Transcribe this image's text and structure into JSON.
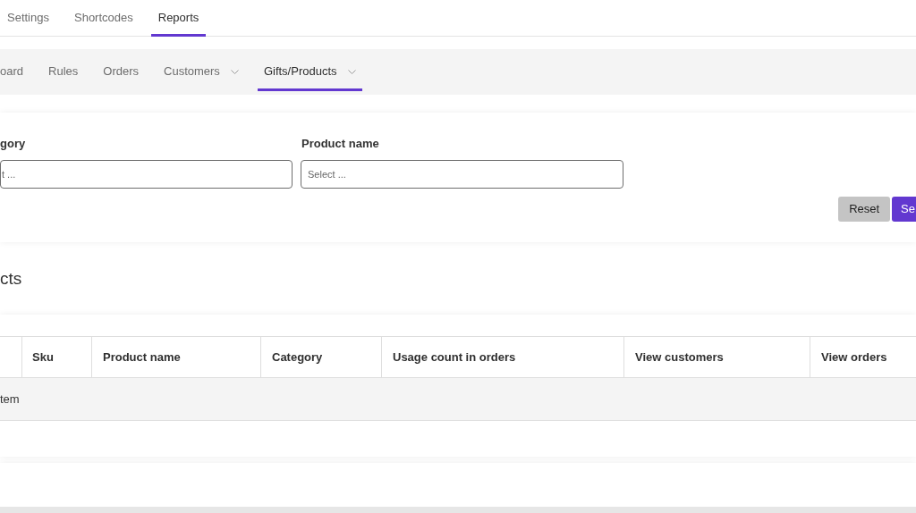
{
  "top_tabs": [
    {
      "label": "Settings",
      "selected": false
    },
    {
      "label": "Shortcodes",
      "selected": false
    },
    {
      "label": "Reports",
      "selected": true
    }
  ],
  "sub_tabs": [
    {
      "label": "oard",
      "selected": false,
      "dropdown": false
    },
    {
      "label": "Rules",
      "selected": false,
      "dropdown": false
    },
    {
      "label": "Orders",
      "selected": false,
      "dropdown": false
    },
    {
      "label": "Customers",
      "selected": false,
      "dropdown": true
    },
    {
      "label": "Gifts/Products",
      "selected": true,
      "dropdown": true
    }
  ],
  "filters": {
    "fields": [
      {
        "label": "gory",
        "placeholder": "t ..."
      },
      {
        "label": "Product name",
        "placeholder": "Select ..."
      }
    ],
    "buttons": [
      {
        "label": "Reset",
        "kind": "secondary"
      },
      {
        "label": "Se",
        "kind": "primary"
      }
    ]
  },
  "section_title": "cts",
  "table": {
    "columns": [
      "Sku",
      "Product name",
      "Category",
      "Usage count in orders",
      "View customers",
      "View orders"
    ],
    "empty_message": "tem"
  }
}
